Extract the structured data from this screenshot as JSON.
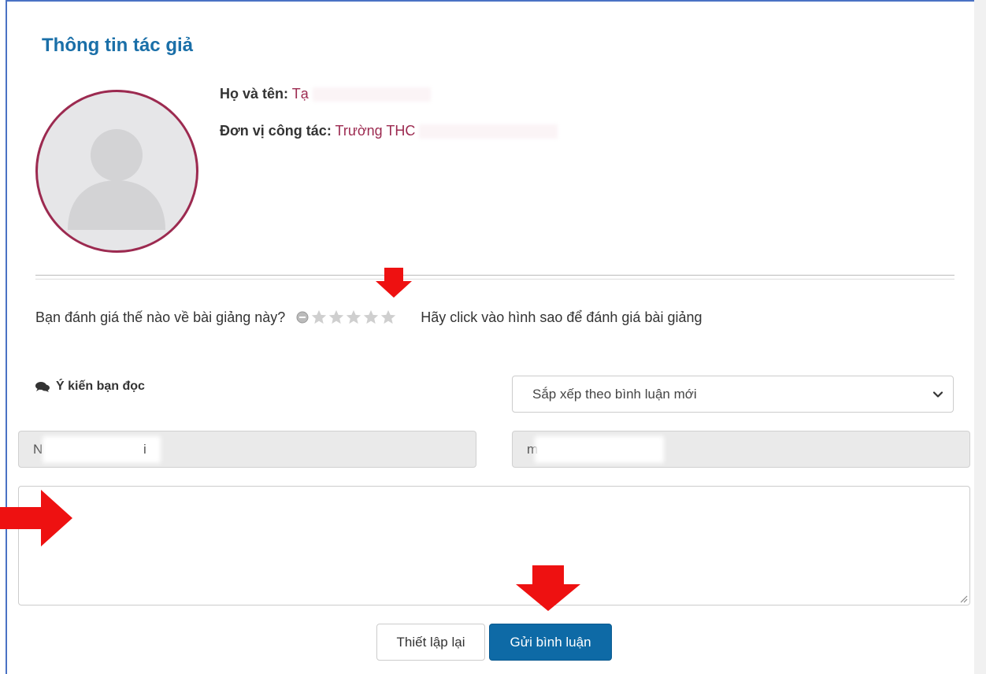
{
  "author_section": {
    "title": "Thông tin tác giả",
    "name_label": "Họ và tên:",
    "name_value": "Tạ",
    "unit_label": "Đơn vị công tác:",
    "unit_value": "Trường THC"
  },
  "rating": {
    "question": "Bạn đánh giá thế nào về bài giảng này?",
    "hint": "Hãy click vào hình sao để đánh giá bài giảng",
    "stars_total": 5,
    "stars_selected": 0
  },
  "comments": {
    "header": "Ý kiến bạn đọc",
    "sort_selected": "Sắp xếp theo bình luận mới",
    "name_value_start": "N",
    "name_value_end": "i",
    "email_value_start": "m",
    "reset_label": "Thiết lập lại",
    "submit_label": "Gửi bình luận"
  },
  "colors": {
    "title": "#1a6fa8",
    "accent_value": "#9c2a50",
    "submit_button": "#0e6aa6",
    "annotation_arrow": "#ee1111",
    "window_border": "#4a72c4"
  },
  "icons": [
    "user-avatar-icon",
    "cancel-rating-icon",
    "star-icon",
    "chat-bubbles-icon",
    "chevron-down-icon",
    "resize-handle-icon",
    "arrow-annotation-icon"
  ]
}
